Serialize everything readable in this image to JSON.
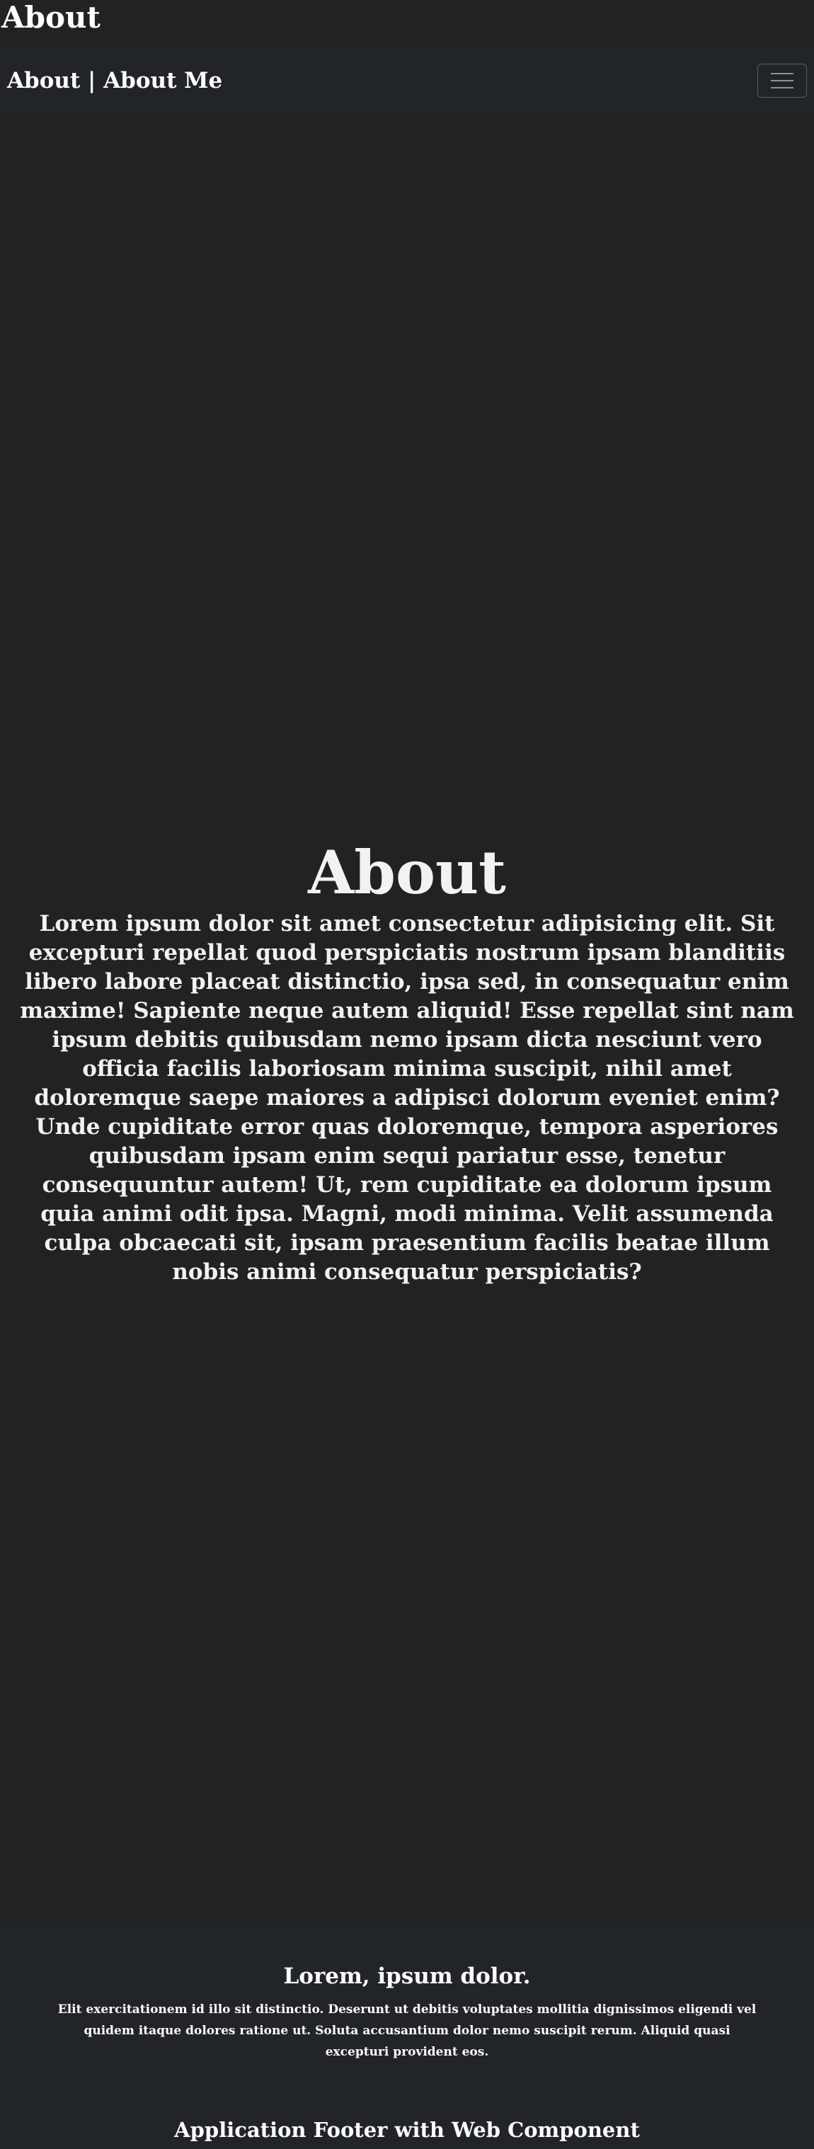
{
  "page": {
    "top_title": "About"
  },
  "navbar": {
    "brand": "About | About Me",
    "toggle_icon": "hamburger-icon"
  },
  "main": {
    "heading": "About",
    "paragraph": "Lorem ipsum dolor sit amet consectetur adipisicing elit. Sit excepturi repellat quod perspiciatis nostrum ipsam blanditiis libero labore placeat distinctio, ipsa sed, in consequatur enim maxime! Sapiente neque autem aliquid! Esse repellat sint nam ipsum debitis quibusdam nemo ipsam dicta nesciunt vero officia facilis laboriosam minima suscipit, nihil amet doloremque saepe maiores a adipisci dolorum eveniet enim? Unde cupiditate error quas doloremque, tempora asperiores quibusdam ipsam enim sequi pariatur esse, tenetur consequuntur autem! Ut, rem cupiditate ea dolorum ipsum quia animi odit ipsa. Magni, modi minima. Velit assumenda culpa obcaecati sit, ipsam praesentium facilis beatae illum nobis animi consequatur perspiciatis?"
  },
  "footer": {
    "title": "Lorem, ipsum dolor.",
    "text": "Elit exercitationem id illo sit distinctio. Deserunt ut debitis voluptates mollitia dignissimos eligendi vel quidem itaque dolores ratione ut. Soluta accusantium dolor nemo suscipit rerum. Aliquid quasi excepturi provident eos.",
    "component_label": "Application Footer with Web Component"
  },
  "colors": {
    "background": "#222222",
    "navbar": "#212529",
    "text": "#f2f2f2"
  }
}
